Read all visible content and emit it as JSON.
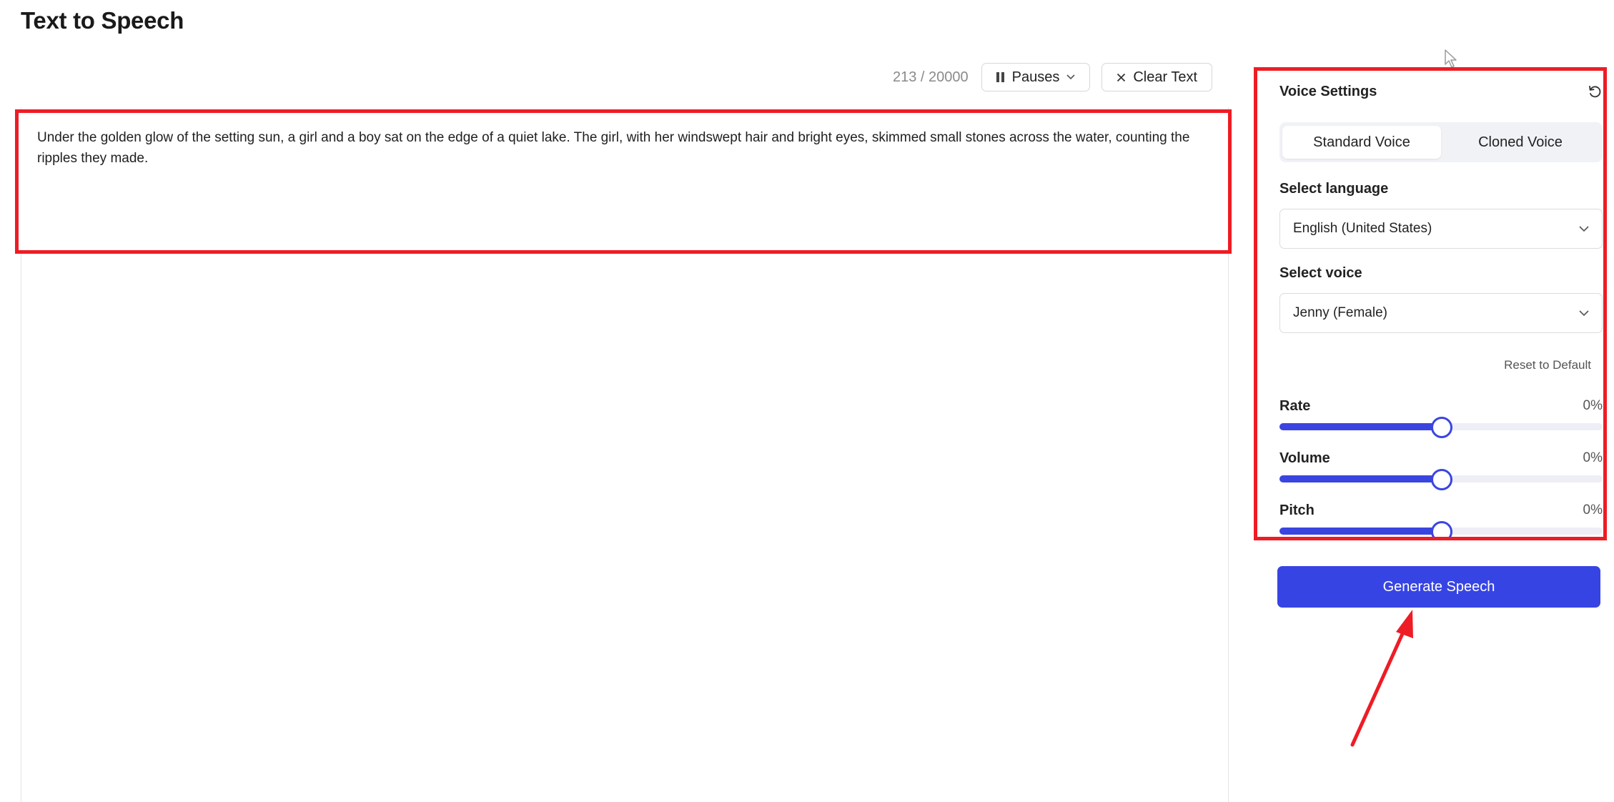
{
  "page": {
    "title": "Text to Speech"
  },
  "toolbar": {
    "char_count": "213 / 20000",
    "pauses_label": "Pauses",
    "clear_label": "Clear Text"
  },
  "editor": {
    "text": "Under the golden glow of the setting sun, a girl and a boy sat on the edge of a quiet lake. The girl, with her windswept hair and bright eyes, skimmed small stones across the water, counting the ripples they made."
  },
  "voice_settings": {
    "title": "Voice Settings",
    "tabs": [
      {
        "label": "Standard Voice",
        "active": true
      },
      {
        "label": "Cloned Voice",
        "active": false
      }
    ],
    "language_label": "Select language",
    "language_value": "English (United States)",
    "voice_label": "Select voice",
    "voice_value": "Jenny (Female)",
    "reset_default_label": "Reset to Default",
    "sliders": [
      {
        "label": "Rate",
        "value_text": "0%",
        "fraction": 0.5
      },
      {
        "label": "Volume",
        "value_text": "0%",
        "fraction": 0.5
      },
      {
        "label": "Pitch",
        "value_text": "0%",
        "fraction": 0.5
      }
    ]
  },
  "generate_label": "Generate Speech",
  "colors": {
    "accent": "#3744e4",
    "annotation": "#ee1c25"
  }
}
